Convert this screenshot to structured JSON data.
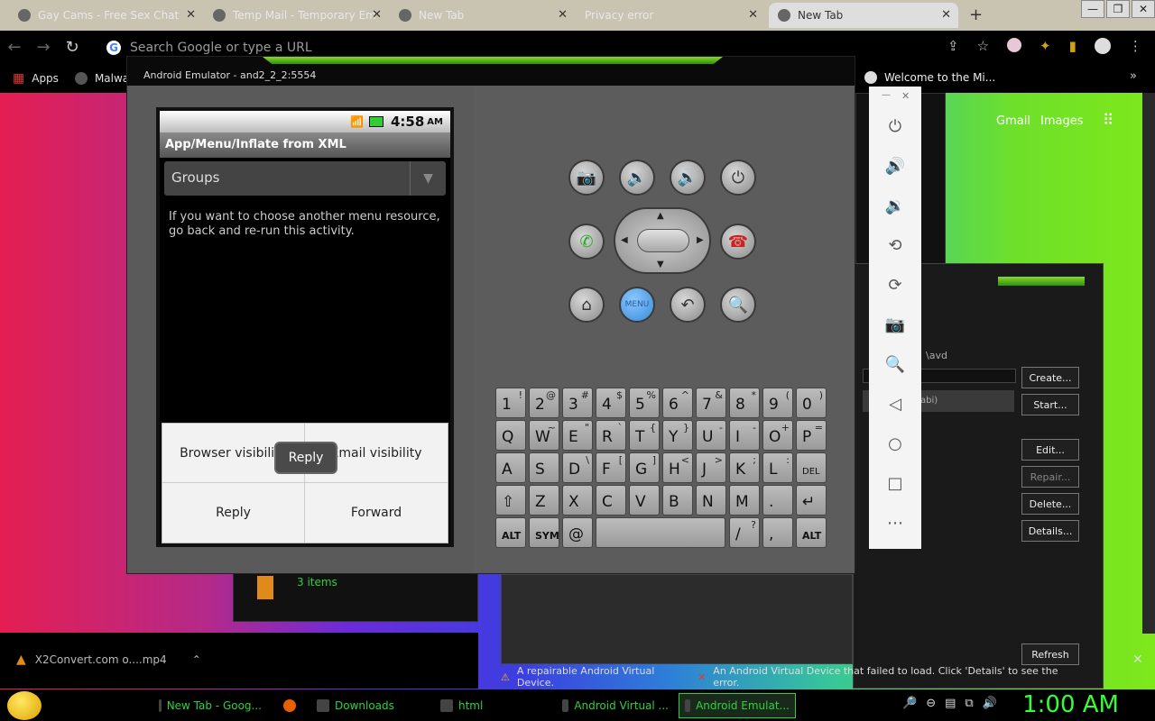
{
  "browser": {
    "tabs": [
      {
        "label": "Gay Cams - Free Sex Chat"
      },
      {
        "label": "Temp Mail - Temporary Em"
      },
      {
        "label": "New Tab"
      },
      {
        "label": "Privacy error"
      },
      {
        "label": "New Tab"
      }
    ],
    "omnibox_placeholder": "Search Google or type a URL",
    "bookmarks": {
      "apps": "Apps",
      "malwa": "Malwa",
      "welcome": "Welcome to the Mi..."
    },
    "google_links": {
      "gmail": "Gmail",
      "images": "Images"
    }
  },
  "emulator": {
    "title": "Android Emulator - and2_2_2:5554",
    "phone": {
      "time": "4:58",
      "ampm": "AM",
      "app_title": "App/Menu/Inflate from XML",
      "spinner_value": "Groups",
      "description": "If you want to choose another menu resource, go back and re-run this activity.",
      "menu_items": [
        "Browser visibility",
        "Email visibility",
        "Reply",
        "Forward"
      ],
      "tooltip": "Reply"
    },
    "menu_button_label": "MENU"
  },
  "keyboard": {
    "rows": [
      [
        [
          "1",
          "!"
        ],
        [
          "2",
          "@"
        ],
        [
          "3",
          "#"
        ],
        [
          "4",
          "$"
        ],
        [
          "5",
          "%"
        ],
        [
          "6",
          "^"
        ],
        [
          "7",
          "&"
        ],
        [
          "8",
          "*"
        ],
        [
          "9",
          "("
        ],
        [
          "0",
          ")"
        ]
      ],
      [
        [
          "Q",
          ""
        ],
        [
          "W",
          "~"
        ],
        [
          "E",
          "\""
        ],
        [
          "R",
          "`"
        ],
        [
          "T",
          "{"
        ],
        [
          "Y",
          "}"
        ],
        [
          "U",
          "-"
        ],
        [
          "I",
          "-"
        ],
        [
          "O",
          "+"
        ],
        [
          "P",
          "="
        ]
      ],
      [
        [
          "A",
          ""
        ],
        [
          "S",
          ""
        ],
        [
          "D",
          "\\"
        ],
        [
          "F",
          "["
        ],
        [
          "G",
          "]"
        ],
        [
          "H",
          "<"
        ],
        [
          "J",
          ">"
        ],
        [
          "K",
          ";"
        ],
        [
          "L",
          ":"
        ],
        [
          "DEL",
          ""
        ]
      ],
      [
        [
          "⇧",
          ""
        ],
        [
          "Z",
          ""
        ],
        [
          "X",
          ""
        ],
        [
          "C",
          ""
        ],
        [
          "V",
          ""
        ],
        [
          "B",
          ""
        ],
        [
          "N",
          ""
        ],
        [
          "M",
          ""
        ],
        [
          ".",
          ""
        ],
        [
          "↵",
          ""
        ]
      ]
    ],
    "bottom": {
      "alt": "ALT",
      "sym": "SYM",
      "at": "@",
      "slash": "/",
      "question": "?",
      "comma": ",",
      "alt2": "ALT"
    }
  },
  "avd_manager": {
    "path": "\\avd",
    "buttons": [
      "Create...",
      "Start...",
      "Edit...",
      "Repair...",
      "Delete...",
      "Details...",
      "Refresh"
    ],
    "row_text": "abi)",
    "status_repairable": "A repairable Android Virtual Device.",
    "status_failed": "An Android Virtual Device that failed to load. Click 'Details' to see the error."
  },
  "explorer_bg": {
    "items_count": "3 items"
  },
  "download": {
    "file": "X2Convert.com o....mp4"
  },
  "taskbar": {
    "items": [
      "New Tab - Goog...",
      "Downloads",
      "html",
      "Android Virtual ...",
      "Android Emulat..."
    ],
    "clock": "1:00 AM"
  }
}
